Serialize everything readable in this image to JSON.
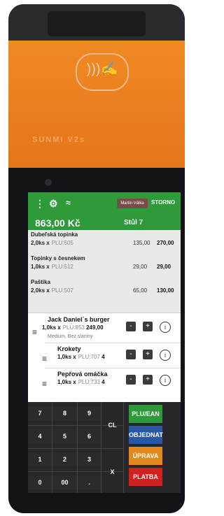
{
  "device": {
    "brand": "SUNMI V2s",
    "nfc_icon": "contactless-payment-icon"
  },
  "header": {
    "user_name": "Martin Válka",
    "storno_label": "STORNO",
    "menu_icon": "more-vertical-icon",
    "settings_icon": "gear-icon",
    "wifi_icon": "wifi-icon",
    "total": "863,00 Kč",
    "table": "Stůl 7",
    "accent_color": "#2e9a3a"
  },
  "items": [
    {
      "name": "Dubeľská topinka",
      "qty": "2,0ks x",
      "plu": "PLU:505",
      "price": "135,00",
      "sum": "270,00"
    },
    {
      "name": "Topinky s česnekem",
      "qty": "1,0ks x",
      "plu": "PLU:512",
      "price": "29,00",
      "sum": "29,00"
    },
    {
      "name": "Paštika",
      "qty": "2,0ks x",
      "plu": "PLU:507",
      "price": "65,00",
      "sum": "130,00"
    }
  ],
  "burger": {
    "name": "Jack Daniel´s burger",
    "qty": "1,0ks x",
    "plu": "PLU:853",
    "price": "249,00",
    "note": "Medium, Bez slaniny",
    "sub1_name": "Krokety",
    "sub1_qty": "1,0ks x",
    "sub1_plu": "PLU:707",
    "sub1_price": "4",
    "sub2_name": "Pepřová omáčka",
    "sub2_qty": "1,0ks x",
    "sub2_plu": "PLU:733",
    "sub2_price": "4",
    "minus": "-",
    "plus": "+",
    "info": "i"
  },
  "keypad": {
    "k7": "7",
    "k8": "8",
    "k9": "9",
    "k4": "4",
    "k5": "5",
    "k6": "6",
    "k1": "1",
    "k2": "2",
    "k3": "3",
    "k0": "0",
    "k00": "00",
    "kdot": ".",
    "cl": "CL",
    "x": "X"
  },
  "actions": {
    "plu": "PLU/EAN",
    "objednat": "OBJEDNAT",
    "uprava": "ÚPRAVA",
    "platba": "PLATBA",
    "plu_color": "#2e9a3a",
    "objednat_color": "#2a57a5",
    "uprava_color": "#e48a1c",
    "platba_color": "#d21f1f"
  }
}
